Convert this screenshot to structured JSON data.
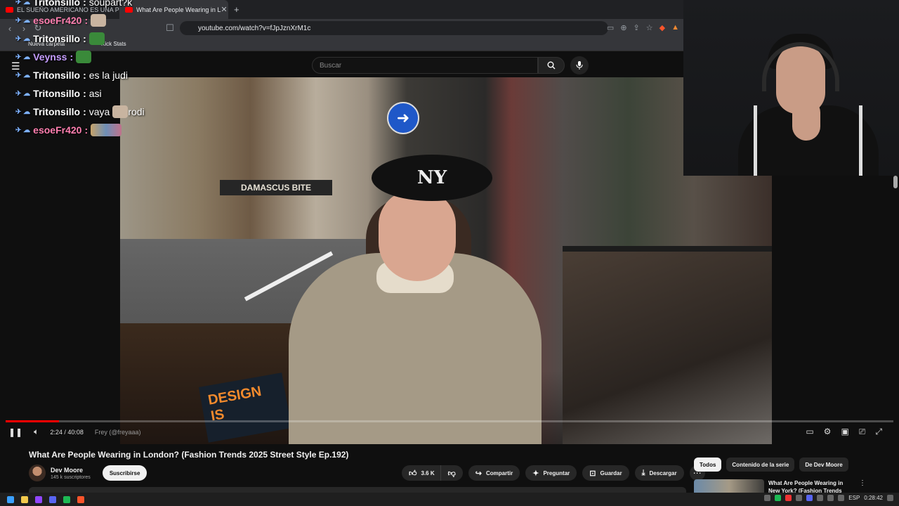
{
  "browser": {
    "tabs": [
      {
        "title": "EL SUEÑO AMERICANO ES UNA PES"
      },
      {
        "title": "What Are People Wearing in L"
      }
    ],
    "url": "youtube.com/watch?v=fJpJznXrM1c",
    "bookmarks": [
      "Nueva carpeta",
      "Kick Stats"
    ]
  },
  "youtube": {
    "search_placeholder": "Buscar",
    "player": {
      "time": "2:24 / 40:08",
      "chapter": "Frey (@freyaaa)",
      "progress_fraction": 0.06
    },
    "video": {
      "title": "What Are People Wearing in London? (Fashion Trends 2025 Street Style Ep.192)",
      "channel": "Dev Moore",
      "subscribers": "145 k suscriptores",
      "subscribe_label": "Suscribirse",
      "likes": "3.6 K",
      "share": "Compartir",
      "ask": "Preguntar",
      "save": "Guardar",
      "download": "Descargar"
    },
    "chips": [
      "Todos",
      "Contenido de la serie",
      "De Dev Moore"
    ],
    "recommendation": {
      "title": "What Are People Wearing in New York? (Fashion Trends"
    },
    "scene_text": {
      "shop_sign": "DAMASCUS BITE",
      "beret_logo": "NY",
      "planter_sign": "DESIGN IS"
    }
  },
  "chat": [
    {
      "user": "Tritonsillo",
      "msg": "soupart?k",
      "color": "#ffffff"
    },
    {
      "user": "esoeFr420",
      "msg": "",
      "color": "#ff7fb0"
    },
    {
      "user": "Tritonsillo",
      "msg": "",
      "color": "#ffffff"
    },
    {
      "user": "Veynss",
      "msg": "",
      "color": "#c59cff"
    },
    {
      "user": "Tritonsillo",
      "msg": "es la judi",
      "color": "#ffffff"
    },
    {
      "user": "Tritonsillo",
      "msg": "asi",
      "color": "#ffffff"
    },
    {
      "user": "Tritonsillo",
      "msg": "vaya",
      "color": "#ffffff"
    },
    {
      "user": "esoeFr420",
      "msg": "",
      "color": "#ff7fb0"
    }
  ],
  "chat_extra": {
    "rodi": "rodi"
  },
  "taskbar": {
    "lang": "ESP",
    "time": "0:28:42"
  },
  "colors": {
    "accent": "#ff0000",
    "background": "#0f0f0f"
  },
  "icons": [
    "menu-icon",
    "search-icon",
    "mic-icon",
    "like-icon",
    "dislike-icon",
    "share-icon",
    "sparkle-icon",
    "save-icon",
    "download-icon",
    "more-icon",
    "pause-icon",
    "volume-icon",
    "settings-icon",
    "fullscreen-icon",
    "back-icon",
    "forward-icon",
    "reload-icon",
    "bookmark-icon"
  ]
}
